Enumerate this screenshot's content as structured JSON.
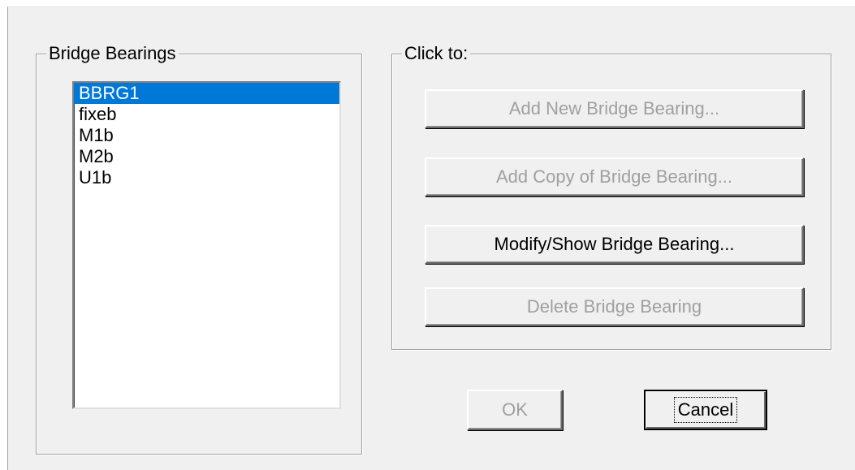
{
  "bearings_group": {
    "title": "Bridge Bearings",
    "items": [
      {
        "label": "BBRG1",
        "selected": true
      },
      {
        "label": "fixeb",
        "selected": false
      },
      {
        "label": "M1b",
        "selected": false
      },
      {
        "label": "M2b",
        "selected": false
      },
      {
        "label": "U1b",
        "selected": false
      }
    ]
  },
  "actions_group": {
    "title": "Click to:",
    "add_new_label": "Add New Bridge Bearing...",
    "add_copy_label": "Add Copy of Bridge Bearing...",
    "modify_label": "Modify/Show Bridge Bearing...",
    "delete_label": "Delete Bridge Bearing"
  },
  "footer": {
    "ok_label": "OK",
    "cancel_label": "Cancel"
  },
  "colors": {
    "selection": "#0078d7",
    "dialog_bg": "#f0f0f0",
    "disabled_text": "#a0a0a0"
  }
}
